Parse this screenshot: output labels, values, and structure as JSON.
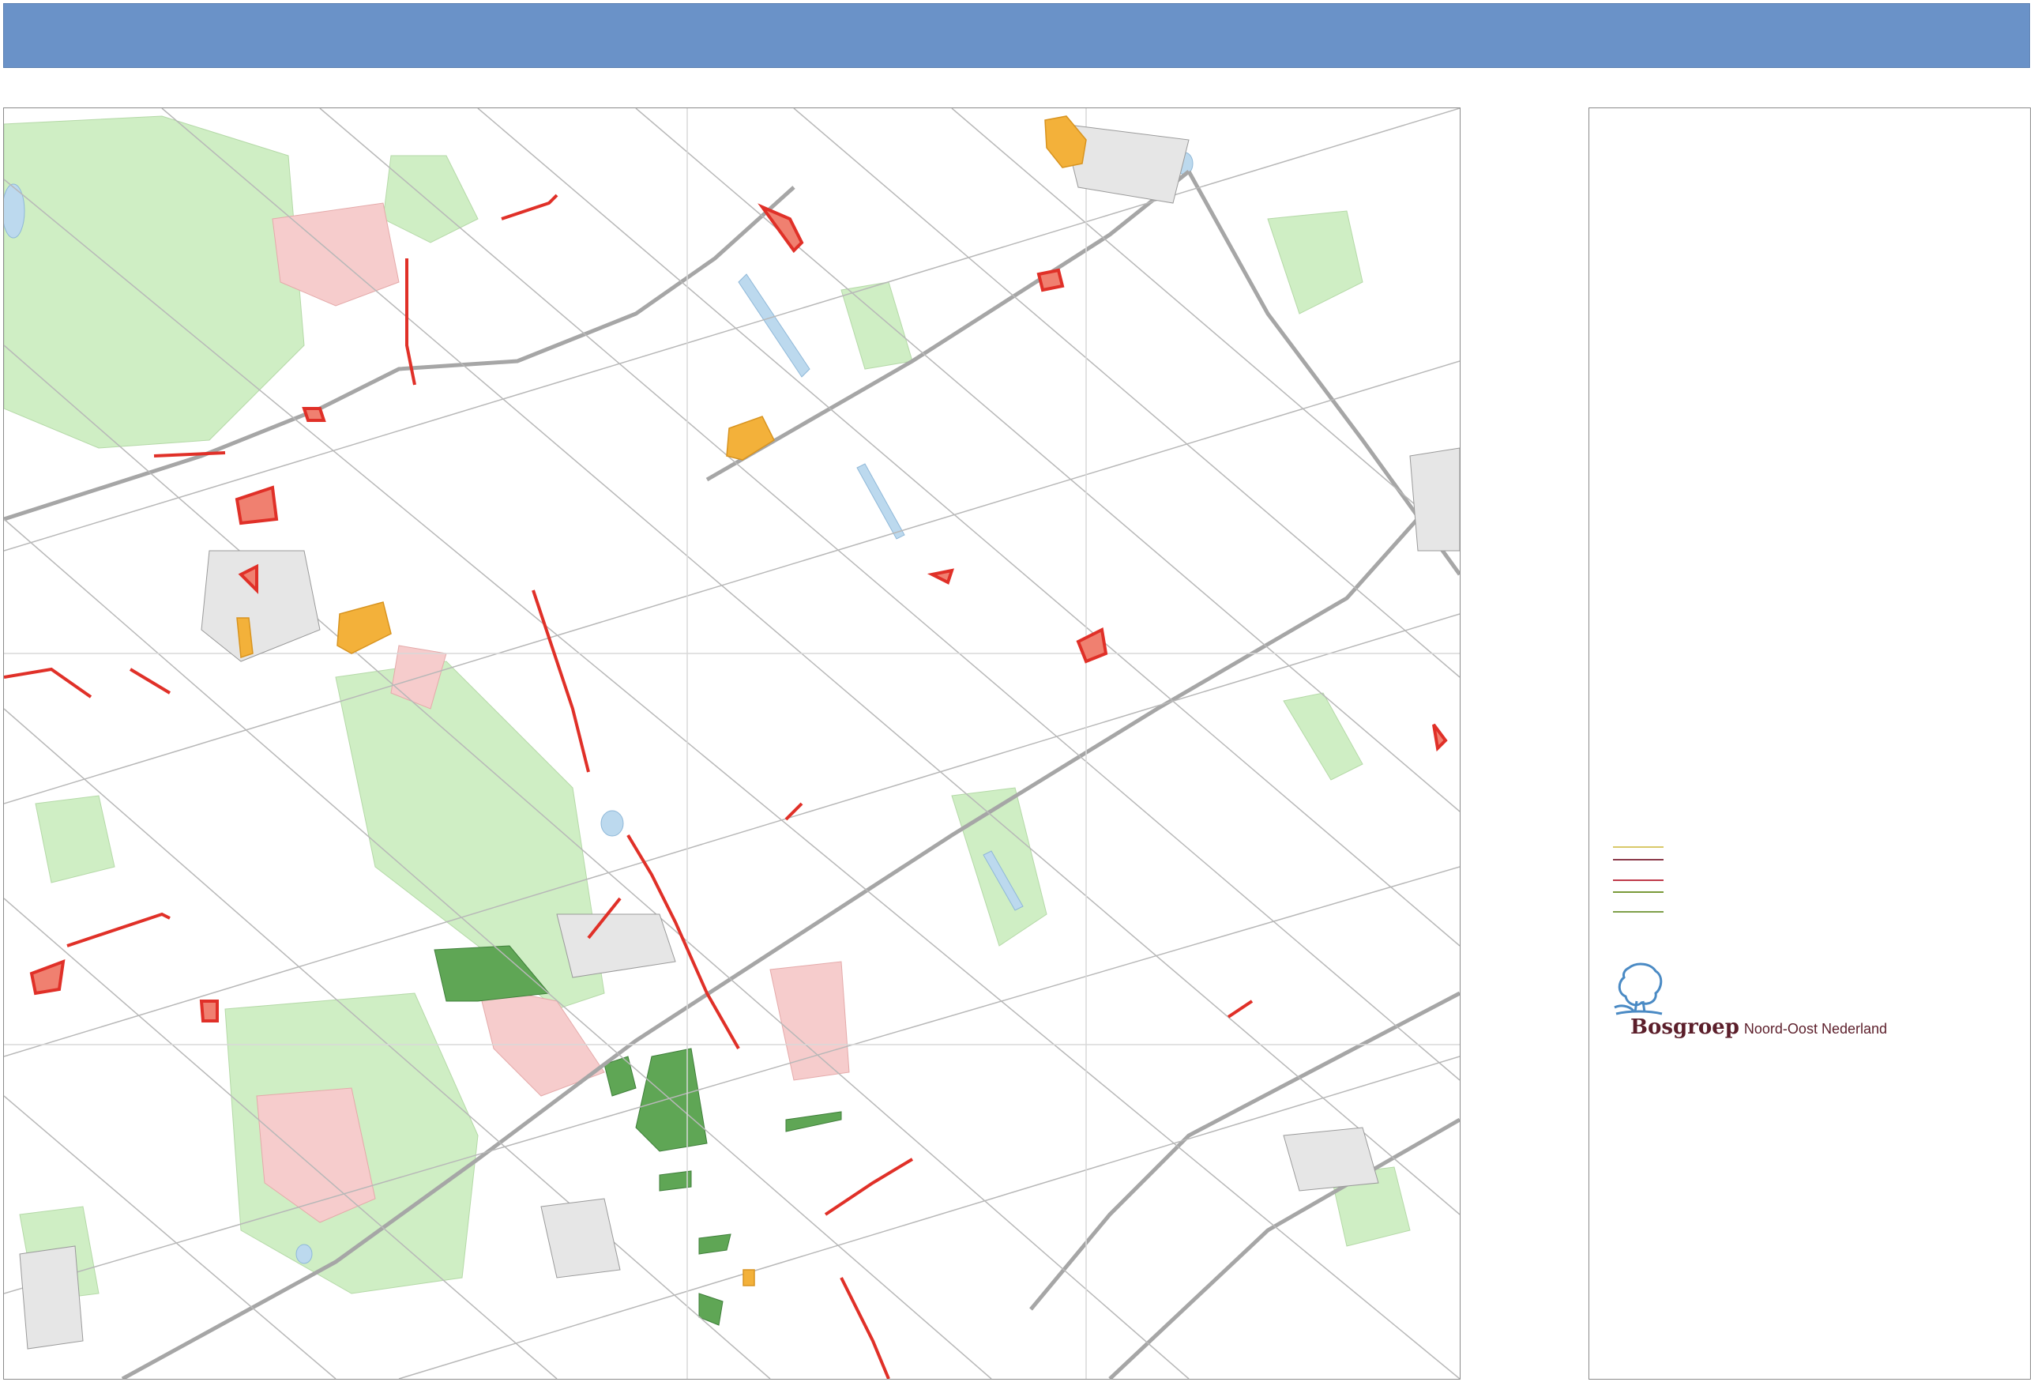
{
  "header": {
    "title": ""
  },
  "legend": {
    "line_colors": [
      "#d9c96a",
      "#8b3a4a",
      "#c03a4a",
      "#7a9a3a",
      "#7fa04a"
    ]
  },
  "logo": {
    "brand": "Bosgroep",
    "subtitle": "Noord-Oost Nederland",
    "icon": "tree-icon",
    "color_text": "#5b1e2a",
    "color_icon": "#4a8ac4"
  },
  "map": {
    "icon": "topographic-map",
    "colors": {
      "forest_light": "#cfeec4",
      "forest_dark": "#5fa655",
      "heath": "#f6cccc",
      "water": "#bcd9ee",
      "roads": "#a6a6a6",
      "parcels_red": "#e03028",
      "parcels_orange": "#f3b13a"
    }
  }
}
